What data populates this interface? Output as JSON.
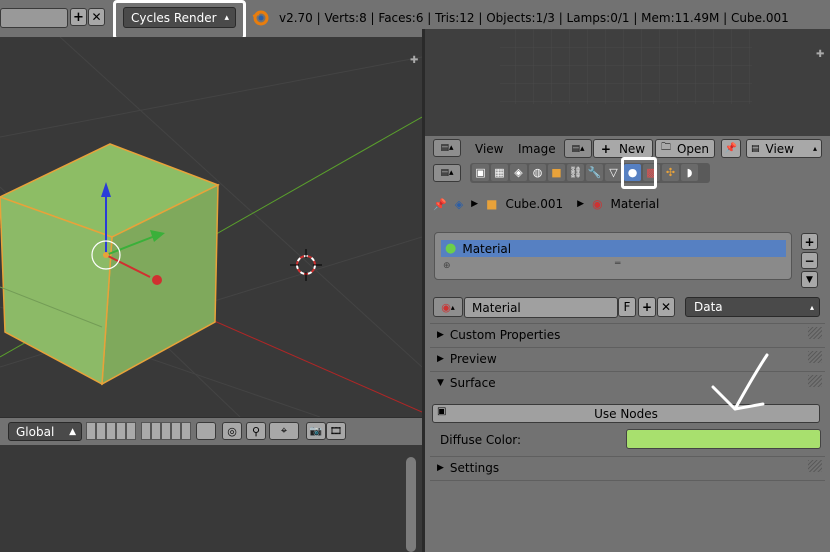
{
  "topbar": {
    "render_engine": "Cycles Render",
    "stats": "v2.70 | Verts:8 | Faces:6 | Tris:12 | Objects:1/3 | Lamps:0/1 | Mem:11.49M | Cube.001",
    "add_icon": "plus-icon",
    "close_icon": "x-icon"
  },
  "view_header": {
    "orientation": "Global"
  },
  "image_header": {
    "view_label": "View",
    "image_label": "Image",
    "new_label": "New",
    "open_label": "Open",
    "view2_label": "View"
  },
  "properties": {
    "breadcrumb_object": "Cube.001",
    "breadcrumb_material": "Material",
    "slot_name": "Material",
    "material_name": "Material",
    "fake_user": "F",
    "link_mode": "Data",
    "panels": {
      "custom_properties": "Custom Properties",
      "preview": "Preview",
      "surface": "Surface",
      "settings": "Settings"
    },
    "use_nodes_label": "Use Nodes",
    "diffuse_label": "Diffuse Color:",
    "diffuse_color": "#a8e06e"
  },
  "colors": {
    "material_green": "#a8e06e",
    "selection_blue": "#5680c2",
    "annotation_white": "#ffffff"
  }
}
